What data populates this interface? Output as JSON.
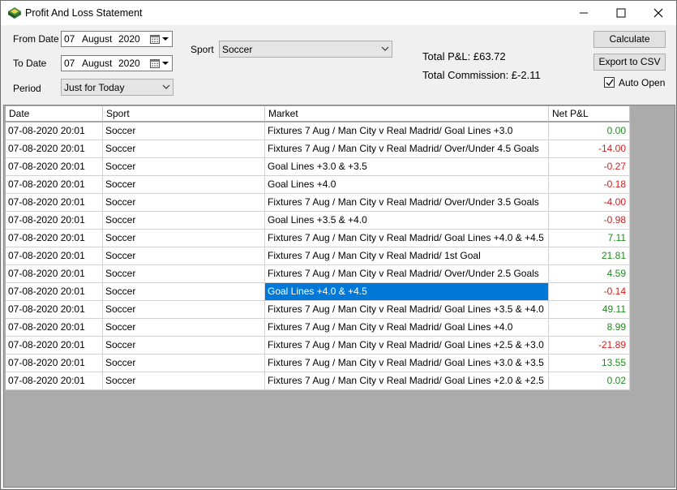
{
  "window": {
    "title": "Profit And Loss Statement"
  },
  "filters": {
    "from_label": "From Date",
    "from_day": "07",
    "from_month": "August",
    "from_year": "2020",
    "to_label": "To Date",
    "to_day": "07",
    "to_month": "August",
    "to_year": "2020",
    "period_label": "Period",
    "period_value": "Just for Today",
    "sport_label": "Sport",
    "sport_value": "Soccer"
  },
  "totals": {
    "pnl": "Total P&L: £63.72",
    "commission": "Total Commission: £-2.11"
  },
  "buttons": {
    "calculate": "Calculate",
    "export": "Export to CSV",
    "auto_open": "Auto Open",
    "auto_open_checked": true
  },
  "table": {
    "columns": [
      "Date",
      "Sport",
      "Market",
      "Net P&L"
    ],
    "rows": [
      {
        "date": "07-08-2020 20:01",
        "sport": "Soccer",
        "market": "Fixtures 7 Aug / Man City v Real Madrid/ Goal Lines +3.0",
        "pnl": "0.00",
        "sign": "pos"
      },
      {
        "date": "07-08-2020 20:01",
        "sport": "Soccer",
        "market": "Fixtures 7 Aug / Man City v Real Madrid/ Over/Under 4.5 Goals",
        "pnl": "-14.00",
        "sign": "neg"
      },
      {
        "date": "07-08-2020 20:01",
        "sport": "Soccer",
        "market": "Goal Lines +3.0 & +3.5",
        "pnl": "-0.27",
        "sign": "neg"
      },
      {
        "date": "07-08-2020 20:01",
        "sport": "Soccer",
        "market": "Goal Lines +4.0",
        "pnl": "-0.18",
        "sign": "neg"
      },
      {
        "date": "07-08-2020 20:01",
        "sport": "Soccer",
        "market": "Fixtures 7 Aug / Man City v Real Madrid/ Over/Under 3.5 Goals",
        "pnl": "-4.00",
        "sign": "neg"
      },
      {
        "date": "07-08-2020 20:01",
        "sport": "Soccer",
        "market": "Goal Lines +3.5 & +4.0",
        "pnl": "-0.98",
        "sign": "neg"
      },
      {
        "date": "07-08-2020 20:01",
        "sport": "Soccer",
        "market": "Fixtures 7 Aug / Man City v Real Madrid/ Goal Lines +4.0 & +4.5",
        "pnl": "7.11",
        "sign": "pos"
      },
      {
        "date": "07-08-2020 20:01",
        "sport": "Soccer",
        "market": "Fixtures 7 Aug / Man City v Real Madrid/ 1st Goal",
        "pnl": "21.81",
        "sign": "pos"
      },
      {
        "date": "07-08-2020 20:01",
        "sport": "Soccer",
        "market": "Fixtures 7 Aug / Man City v Real Madrid/ Over/Under 2.5 Goals",
        "pnl": "4.59",
        "sign": "pos"
      },
      {
        "date": "07-08-2020 20:01",
        "sport": "Soccer",
        "market": "Goal Lines +4.0 & +4.5",
        "pnl": "-0.14",
        "sign": "neg",
        "selected": true
      },
      {
        "date": "07-08-2020 20:01",
        "sport": "Soccer",
        "market": "Fixtures 7 Aug / Man City v Real Madrid/ Goal Lines +3.5 & +4.0",
        "pnl": "49.11",
        "sign": "pos"
      },
      {
        "date": "07-08-2020 20:01",
        "sport": "Soccer",
        "market": "Fixtures 7 Aug / Man City v Real Madrid/ Goal Lines +4.0",
        "pnl": "8.99",
        "sign": "pos"
      },
      {
        "date": "07-08-2020 20:01",
        "sport": "Soccer",
        "market": "Fixtures 7 Aug / Man City v Real Madrid/ Goal Lines +2.5 & +3.0",
        "pnl": "-21.89",
        "sign": "neg"
      },
      {
        "date": "07-08-2020 20:01",
        "sport": "Soccer",
        "market": "Fixtures 7 Aug / Man City v Real Madrid/ Goal Lines +3.0 & +3.5",
        "pnl": "13.55",
        "sign": "pos"
      },
      {
        "date": "07-08-2020 20:01",
        "sport": "Soccer",
        "market": "Fixtures 7 Aug / Man City v Real Madrid/ Goal Lines +2.0 & +2.5",
        "pnl": "0.02",
        "sign": "pos"
      }
    ]
  },
  "colors": {
    "selection": "#0078d7",
    "positive": "#1e8c1e",
    "negative": "#d21e1e"
  }
}
